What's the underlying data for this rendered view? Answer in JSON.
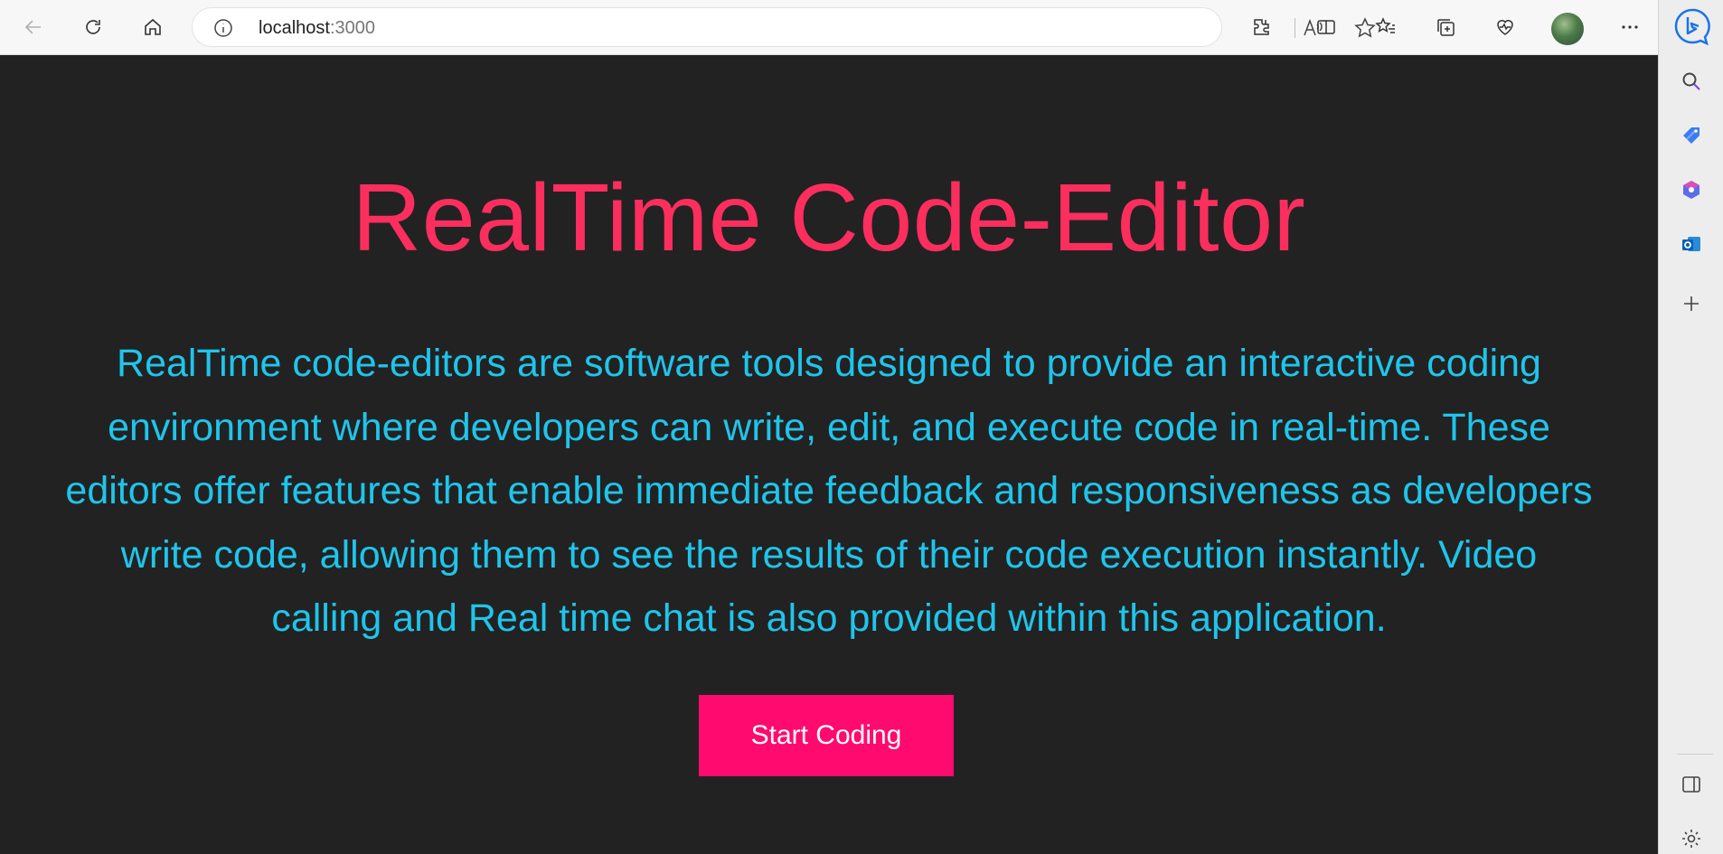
{
  "browser": {
    "url_host": "localhost",
    "url_port": ":3000",
    "accent": "#1a73e8"
  },
  "page": {
    "title": "RealTime Code-Editor",
    "description": "RealTime code-editors are software tools designed to provide an interactive coding environment where developers can write, edit, and execute code in real-time. These editors offer features that enable immediate feedback and responsiveness as developers write code, allowing them to see the results of their code execution instantly. Video calling and Real time chat is also provided within this application.",
    "cta_label": "Start Coding",
    "colors": {
      "background": "#222223",
      "title": "#fc2e5d",
      "description": "#1fc5ea",
      "button": "#ff0a6f"
    }
  },
  "icons": {
    "toolbar": [
      "back-icon",
      "refresh-icon",
      "home-icon",
      "info-icon",
      "read-aloud-icon",
      "favorite-star-icon",
      "extensions-icon",
      "split-screen-icon",
      "favorites-icon",
      "collections-icon",
      "browser-essentials-icon",
      "profile-avatar",
      "more-icon",
      "bing-copilot-icon"
    ],
    "sidebar": [
      "search-icon",
      "shopping-tag-icon",
      "office-icon",
      "outlook-icon",
      "add-icon",
      "sidebar-toggle-icon",
      "settings-icon"
    ]
  }
}
